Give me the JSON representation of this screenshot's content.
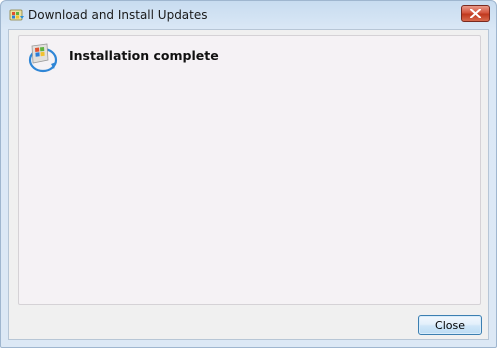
{
  "window": {
    "title": "Download and Install Updates",
    "title_icon": "windows-update-icon",
    "close_icon": "close-icon"
  },
  "content": {
    "icon": "windows-update-icon",
    "heading": "Installation complete"
  },
  "footer": {
    "close_label": "Close"
  },
  "colors": {
    "titlebar_close": "#c0391f",
    "button_border": "#3c7fb1",
    "panel_background": "#f5f2f5"
  }
}
